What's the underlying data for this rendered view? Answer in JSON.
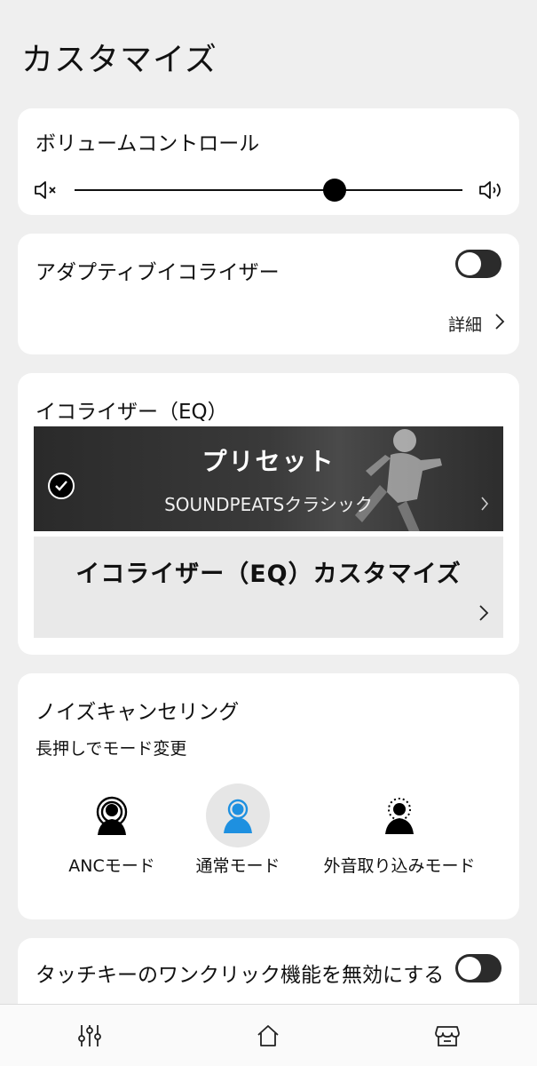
{
  "page": {
    "title": "カスタマイズ"
  },
  "volume": {
    "title": "ボリュームコントロール",
    "level": 0.67,
    "mute_icon": "speaker-muted-icon",
    "max_icon": "speaker-loud-icon"
  },
  "adaptive_eq": {
    "title": "アダプティブイコライザー",
    "enabled": false,
    "detail_label": "詳細"
  },
  "eq": {
    "title": "イコライザー（EQ）",
    "preset": {
      "title": "プリセット",
      "subtitle": "SOUNDPEATSクラシック",
      "selected": true
    },
    "custom": {
      "title": "イコライザー（EQ）カスタマイズ"
    }
  },
  "noise_cancel": {
    "title": "ノイズキャンセリング",
    "subtitle": "長押しでモード変更",
    "modes": [
      {
        "label": "ANCモード",
        "active": false
      },
      {
        "label": "通常モード",
        "active": true
      },
      {
        "label": "外音取り込みモード",
        "active": false
      }
    ]
  },
  "touch": {
    "title": "タッチキーのワンクリック機能を無効にする",
    "enabled": false
  },
  "bottom_nav": {
    "items": [
      "equalizer-sliders-icon",
      "home-icon",
      "store-icon"
    ]
  },
  "colors": {
    "background": "#efefef",
    "card": "#ffffff",
    "accent_blue": "#1e90e0",
    "toggle_off": "#2b2b2b"
  }
}
